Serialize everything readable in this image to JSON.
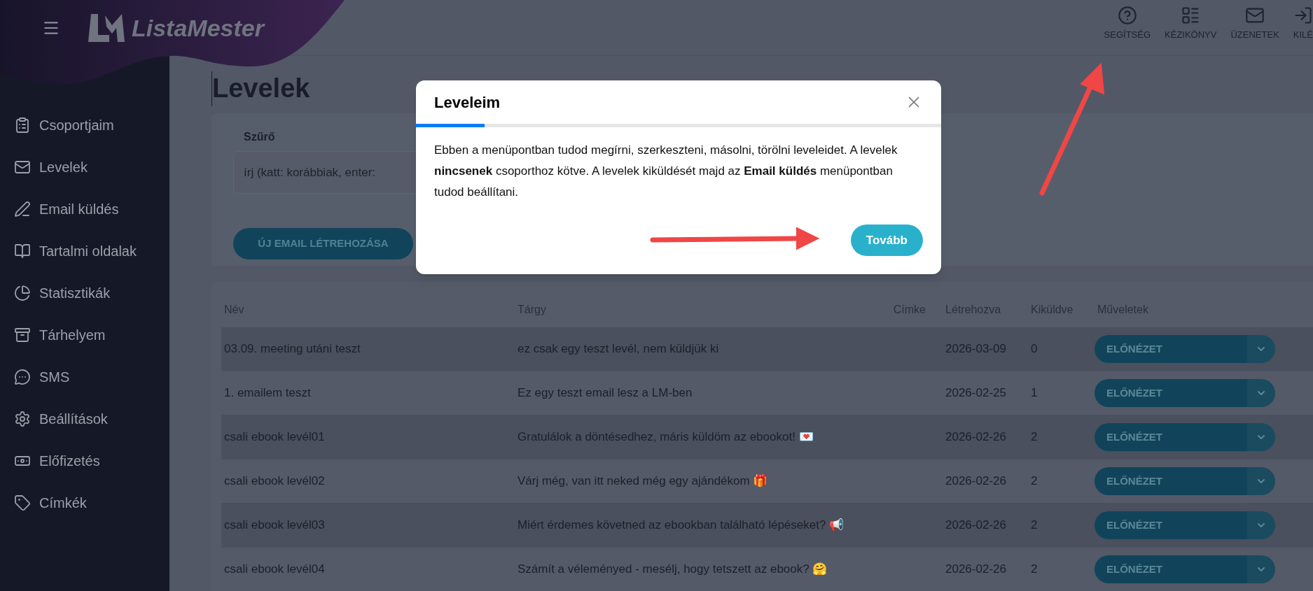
{
  "sidebar": {
    "logo": "ListaMester",
    "items": [
      {
        "label": "Csoportjaim"
      },
      {
        "label": "Levelek"
      },
      {
        "label": "Email küldés"
      },
      {
        "label": "Tartalmi oldalak"
      },
      {
        "label": "Statisztikák"
      },
      {
        "label": "Tárhelyem"
      },
      {
        "label": "SMS"
      },
      {
        "label": "Beállítások"
      },
      {
        "label": "Előfizetés"
      },
      {
        "label": "Címkék"
      }
    ]
  },
  "header": {
    "links": [
      {
        "label": "SEGÍTSÉG"
      },
      {
        "label": "KÉZIKÖNYV"
      },
      {
        "label": "ÜZENETEK"
      },
      {
        "label": "KILÉ"
      }
    ]
  },
  "page": {
    "title": "Levelek",
    "filter": {
      "label": "Szűrő",
      "placeholder": "írj (katt: korábbiak, enter:"
    },
    "create_button": "ÚJ EMAIL LÉTREHOZÁSA"
  },
  "table": {
    "columns": [
      "Név",
      "Tárgy",
      "Címke",
      "Létrehozva",
      "Kiküldve",
      "Műveletek"
    ],
    "rows": [
      {
        "name": "03.09. meeting utáni teszt",
        "subject": "ez csak egy teszt levél, nem küldjük ki",
        "created": "2026-03-09",
        "sent": "0",
        "action": "ELŐNÉZET"
      },
      {
        "name": "1. emailem teszt",
        "subject": "Ez egy teszt email lesz a LM-ben",
        "created": "2026-02-25",
        "sent": "1",
        "action": "ELŐNÉZET"
      },
      {
        "name": "csali ebook levél01",
        "subject": "Gratulálok a döntésedhez, máris küldöm az ebookot! 💌",
        "created": "2026-02-26",
        "sent": "2",
        "action": "ELŐNÉZET"
      },
      {
        "name": "csali ebook levél02",
        "subject": "Várj még, van itt neked még egy ajándékom 🎁",
        "created": "2026-02-26",
        "sent": "2",
        "action": "ELŐNÉZET"
      },
      {
        "name": "csali ebook levél03",
        "subject": "Miért érdemes követned az ebookban található lépéseket? 📢",
        "created": "2026-02-26",
        "sent": "2",
        "action": "ELŐNÉZET"
      },
      {
        "name": "csali ebook levél04",
        "subject": "Számít a véleményed - mesélj, hogy tetszett az ebook? 🤗",
        "created": "2026-02-26",
        "sent": "2",
        "action": "ELŐNÉZET"
      }
    ]
  },
  "modal": {
    "title": "Leveleim",
    "progress": {
      "level": 0.13
    },
    "body": "Ebben a menüpontban tudod megírni, szerkeszteni, másolni, törölni leveleidet. A levelek **nincsenek** csoporthoz kötve. A levelek kiküldését majd az **Email küldés** menüpontban tudod beállítani.",
    "button": "Tovább"
  }
}
